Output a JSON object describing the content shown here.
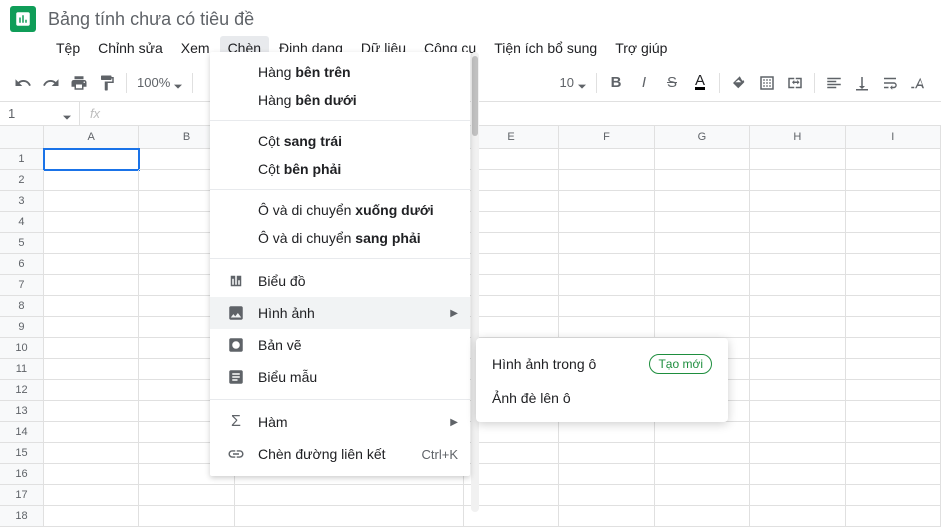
{
  "doc_title": "Bảng tính chưa có tiêu đề",
  "menubar": [
    "Tệp",
    "Chỉnh sửa",
    "Xem",
    "Chèn",
    "Định dạng",
    "Dữ liệu",
    "Công cụ",
    "Tiện ích bổ sung",
    "Trợ giúp"
  ],
  "menubar_active": 3,
  "toolbar": {
    "zoom": "100%",
    "fontsize": "10"
  },
  "namebox": "1",
  "columns": [
    "A",
    "B",
    "E",
    "F",
    "G",
    "H",
    "I"
  ],
  "row_count": 18,
  "selected_cell": "A1",
  "insert_menu": {
    "rows": [
      {
        "pre": "Hàng ",
        "bold": "bên trên"
      },
      {
        "pre": "Hàng ",
        "bold": "bên dưới"
      }
    ],
    "cols": [
      {
        "pre": "Cột ",
        "bold": "sang trái"
      },
      {
        "pre": "Cột ",
        "bold": "bên phải"
      }
    ],
    "cells": [
      {
        "pre": "Ô và di chuyển ",
        "bold": "xuống dưới"
      },
      {
        "pre": "Ô và di chuyển ",
        "bold": "sang phải"
      }
    ],
    "chart": "Biểu đồ",
    "image": "Hình ảnh",
    "drawing": "Bản vẽ",
    "form": "Biểu mẫu",
    "function": "Hàm",
    "link": "Chèn đường liên kết",
    "link_shortcut": "Ctrl+K"
  },
  "image_submenu": {
    "in_cell": "Hình ảnh trong ô",
    "over_cells": "Ảnh đè lên ô",
    "badge": "Tạo mới"
  }
}
